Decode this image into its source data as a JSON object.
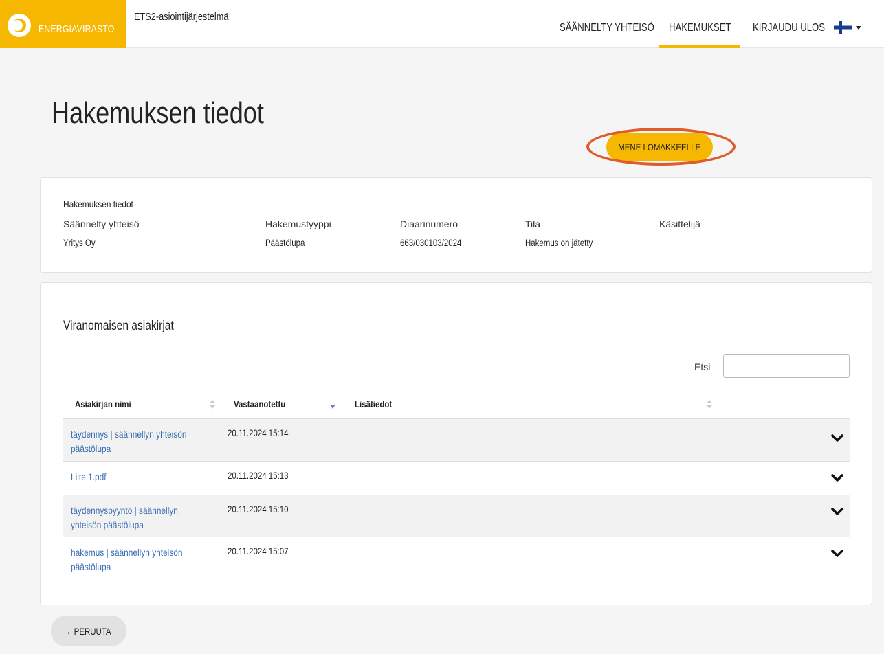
{
  "header": {
    "logo_text": "ENERGIAVIRASTO",
    "app_title": "ETS2-asiointijärjestelmä",
    "nav": [
      {
        "label": "SÄÄNNELTY YHTEISÖ"
      },
      {
        "label": "HAKEMUKSET"
      },
      {
        "label": "KIRJAUDU ULOS"
      }
    ],
    "language_icon": "finland-flag-icon"
  },
  "page": {
    "title": "Hakemuksen tiedot",
    "go_button": "MENE LOMAKKEELLE"
  },
  "info": {
    "heading": "Hakemuksen tiedot",
    "fields": [
      {
        "label": "Säännelty yhteisö",
        "value": "Yritys Oy"
      },
      {
        "label": "Hakemustyyppi",
        "value": "Päästölupa"
      },
      {
        "label": "Diaarinumero",
        "value": "663/030103/2024"
      },
      {
        "label": "Tila",
        "value": "Hakemus on jätetty"
      },
      {
        "label": "Käsittelijä",
        "value": ""
      }
    ]
  },
  "documents": {
    "heading": "Viranomaisen asiakirjat",
    "search_label": "Etsi",
    "search_value": "",
    "columns": [
      "Asiakirjan nimi",
      "Vastaanotettu",
      "Lisätiedot"
    ],
    "rows": [
      {
        "name": "täydennys | säännellyn yhteisön päästölupa",
        "received": "20.11.2024 15:14",
        "info": ""
      },
      {
        "name": "Liite 1.pdf",
        "received": "20.11.2024 15:13",
        "info": ""
      },
      {
        "name": "täydennyspyyntö | säännellyn yhteisön päästölupa",
        "received": "20.11.2024 15:10",
        "info": ""
      },
      {
        "name": "hakemus | säännellyn yhteisön päästölupa",
        "received": "20.11.2024 15:07",
        "info": ""
      }
    ]
  },
  "footer": {
    "cancel_button": "←PERUUTA"
  },
  "colors": {
    "brand_yellow": "#f6b700",
    "link_blue": "#3a6fb5",
    "highlight_ring": "#e05a2b"
  }
}
